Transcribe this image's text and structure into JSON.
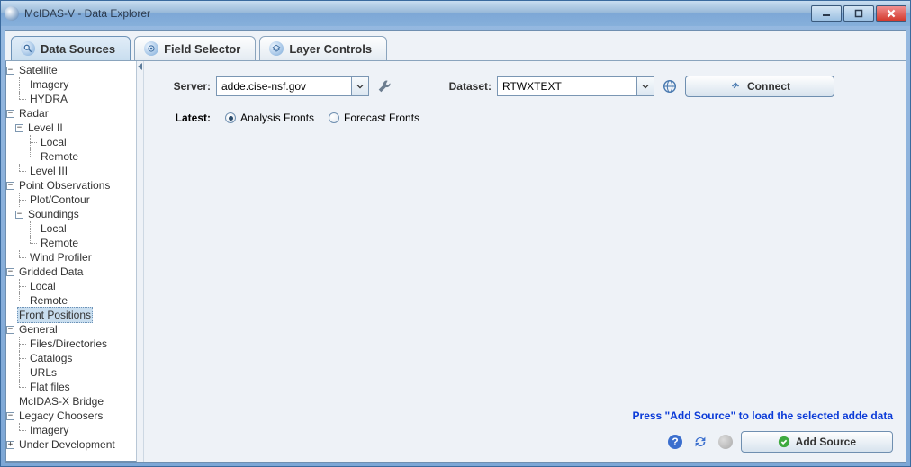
{
  "window": {
    "title": "McIDAS-V - Data Explorer"
  },
  "tabs": [
    {
      "label": "Data Sources",
      "active": true
    },
    {
      "label": "Field Selector",
      "active": false
    },
    {
      "label": "Layer Controls",
      "active": false
    }
  ],
  "tree": {
    "Satellite": [
      "Imagery",
      "HYDRA"
    ],
    "Radar": {
      "Level II": [
        "Local",
        "Remote"
      ],
      "Level III": []
    },
    "Point Observations": {
      "Plot/Contour": [],
      "Soundings": [
        "Local",
        "Remote"
      ],
      "Wind Profiler": []
    },
    "Gridded Data": [
      "Local",
      "Remote"
    ],
    "Front Positions": [],
    "General": [
      "Files/Directories",
      "Catalogs",
      "URLs",
      "Flat files"
    ],
    "McIDAS-X Bridge": [],
    "Legacy Choosers": [
      "Imagery"
    ],
    "Under Development": []
  },
  "selected_node": "Front Positions",
  "labels": {
    "satellite": "Satellite",
    "imagery": "Imagery",
    "hydra": "HYDRA",
    "radar": "Radar",
    "level2": "Level II",
    "local": "Local",
    "remote": "Remote",
    "level3": "Level III",
    "pointobs": "Point Observations",
    "plotcontour": "Plot/Contour",
    "soundings": "Soundings",
    "windprof": "Wind Profiler",
    "gridded": "Gridded Data",
    "frontpos": "Front Positions",
    "general": "General",
    "filesdirs": "Files/Directories",
    "catalogs": "Catalogs",
    "urls": "URLs",
    "flatfiles": "Flat files",
    "mcidasxbridge": "McIDAS-X Bridge",
    "legacy": "Legacy Choosers",
    "underdev": "Under Development"
  },
  "form": {
    "server_label": "Server:",
    "server_value": "adde.cise-nsf.gov",
    "dataset_label": "Dataset:",
    "dataset_value": "RTWXTEXT",
    "connect_label": "Connect",
    "latest_label": "Latest:",
    "radio_analysis": "Analysis Fronts",
    "radio_forecast": "Forecast Fronts",
    "radio_selected": "analysis"
  },
  "footer": {
    "hint": "Press \"Add Source\" to load the selected adde data",
    "add_source_label": "Add Source"
  }
}
